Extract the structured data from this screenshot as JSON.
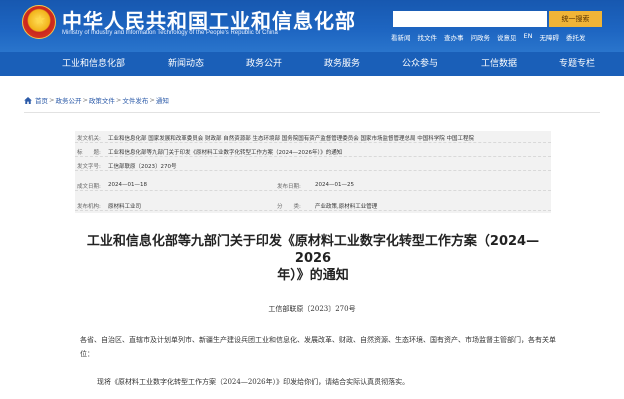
{
  "header": {
    "title": "中华人民共和国工业和信息化部",
    "subtitle": "Ministry of Industry and Information Technology of the People's Republic of China",
    "search": {
      "placeholder": "",
      "button_label": "统一搜索"
    },
    "quicklinks": [
      "看新闻",
      "找文件",
      "查办事",
      "问政务",
      "说意见",
      "EN",
      "无障碍",
      "委托发"
    ]
  },
  "nav": {
    "items": [
      "工业和信息化部",
      "新闻动态",
      "政务公开",
      "政务服务",
      "公众参与",
      "工信数据",
      "专题专栏"
    ]
  },
  "breadcrumb": {
    "items": [
      "首页",
      "政务公开",
      "政策文件",
      "文件发布",
      "通知"
    ],
    "separator": ">"
  },
  "meta": {
    "issuer_label": "发文机关:",
    "issuer_value": "工业和信息化部 国家发展和改革委员会 财政部 自然资源部 生态环境部 国务院国有资产监督管理委员会 国家市场监督管理总局 中国科学院 中国工程院",
    "title_label": "标　　题:",
    "title_value": "工业和信息化部等九部门关于印发《原材料工业数字化转型工作方案（2024—2026年）》的通知",
    "docno_label": "发文字号:",
    "docno_value": "工信部联原〔2023〕270号",
    "written_label": "成文日期:",
    "written_value": "2024—01—18",
    "published_label": "发布日期:",
    "published_value": "2024—01—25",
    "unit_label": "发布机构:",
    "unit_value": "原材料工业司",
    "category_label": "分　　类:",
    "category_value": "产业政策,原材料工业管理"
  },
  "article": {
    "title_line1": "工业和信息化部等九部门关于印发《原材料工业数字化转型工作方案（2024—2026",
    "title_line2": "年）》的通知",
    "doc_number": "工信部联原〔2023〕270号",
    "recipients": "各省、自治区、直辖市及计划单列市、新疆生产建设兵团工业和信息化、发展改革、财政、自然资源、生态环境、国有资产、市场监督主管部门，各有关单位：",
    "body_first": "现将《原材料工业数字化转型工作方案（2024—2026年）》印发给你们，请结合实际认真贯彻落实。"
  },
  "colors": {
    "header_blue": "#1758b0",
    "nav_blue": "#1a5fb8",
    "search_button": "#f0b437",
    "link_blue": "#2b5aa8"
  }
}
